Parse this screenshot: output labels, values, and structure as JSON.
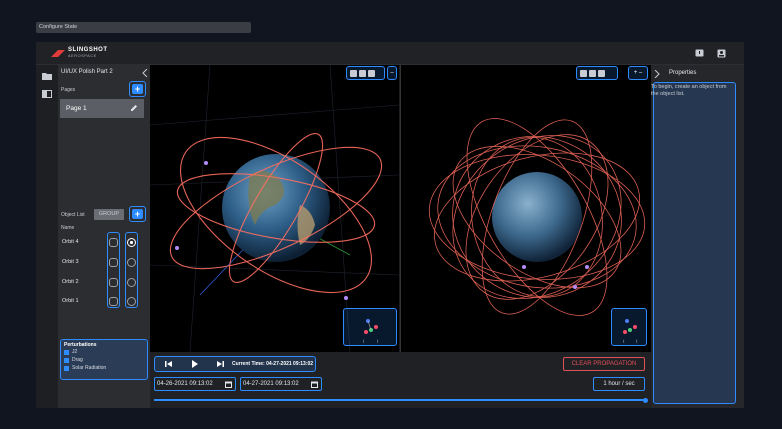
{
  "config_chip": "Configure State",
  "brand": {
    "name": "SLINGSHOT",
    "sub": "AEROSPACE"
  },
  "topbar_icons": [
    "feedback-icon",
    "account-icon"
  ],
  "rail_icons": [
    "folder-icon",
    "book-icon"
  ],
  "project": {
    "title": "UI/UX Polish Part 2"
  },
  "pages": {
    "label": "Pages",
    "items": [
      {
        "label": "Page 1"
      }
    ]
  },
  "objects": {
    "label": "Object List",
    "group_label": "GROUP",
    "column_name": "Name",
    "items": [
      {
        "name": "Orbit 4",
        "visible": true
      },
      {
        "name": "Orbit 3",
        "visible": false
      },
      {
        "name": "Orbit 2",
        "visible": false
      },
      {
        "name": "Orbit 1",
        "visible": false
      }
    ]
  },
  "perturbations": {
    "label": "Perturbations",
    "items": [
      {
        "label": "J2",
        "checked": true
      },
      {
        "label": "Drag",
        "checked": true
      },
      {
        "label": "Solar Radiation",
        "checked": true
      }
    ]
  },
  "playback": {
    "current_time_label": "Current Time: 04-27-2021 09:13:02",
    "clear_label": "CLEAR PROPAGATION",
    "start_date": "04-26-2021 09:13:02",
    "end_date": "04-27-2021 09:13:02",
    "rate": "1 hour / sec",
    "progress": 1.0
  },
  "properties": {
    "title": "Properties",
    "hint": "To begin, create an object from the object list."
  },
  "colors": {
    "accent": "#2d8cff",
    "orbit": "#ff6f61",
    "clear": "#e0525a"
  }
}
